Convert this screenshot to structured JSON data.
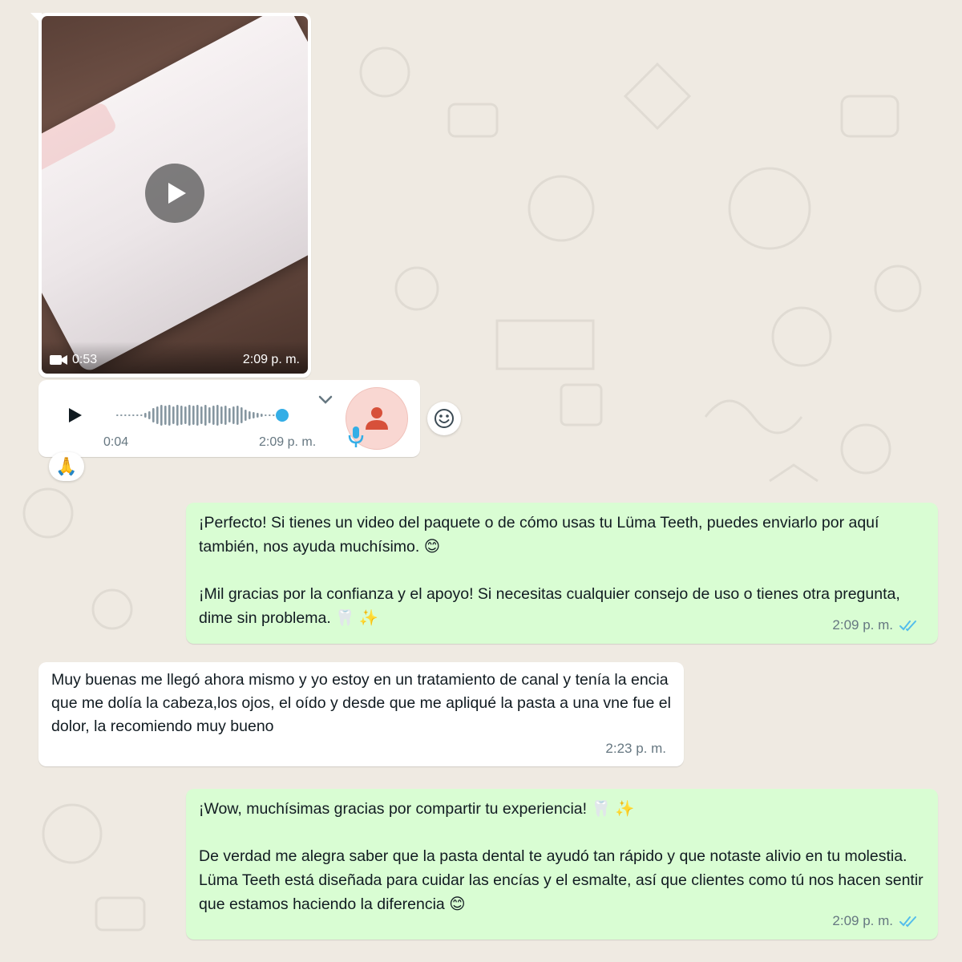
{
  "chat": {
    "video": {
      "duration": "0:53",
      "time": "2:09 p. m."
    },
    "audio": {
      "duration": "0:04",
      "time": "2:09 p. m.",
      "progress": 1.0
    },
    "reaction": "🙏",
    "messages": [
      {
        "direction": "outgoing",
        "paragraphs": [
          "¡Perfecto! Si tienes un video del paquete o de cómo usas tu Lüma Teeth, puedes enviarlo por aquí también, nos ayuda muchísimo. 😊",
          "¡Mil gracias por la confianza y el apoyo! Si necesitas cualquier consejo de uso o tienes otra pregunta, dime sin problema. 🦷 ✨"
        ],
        "time": "2:09 p. m.",
        "status": "read"
      },
      {
        "direction": "incoming",
        "paragraphs": [
          "Muy buenas me llegó ahora mismo y yo estoy en un tratamiento de canal y tenía la encia que me dolía la cabeza,los ojos, el oído y desde que me apliqué la pasta a una vne fue el dolor, la recomiendo muy bueno"
        ],
        "time": "2:23 p. m."
      },
      {
        "direction": "outgoing",
        "paragraphs": [
          "¡Wow, muchísimas gracias por compartir tu experiencia! 🦷 ✨",
          "De verdad me alegra saber que la pasta dental te ayudó tan rápido y que notaste alivio en tu molestia. Lüma Teeth está diseñada para cuidar las encías y el esmalte, así que clientes como tú nos hacen sentir que estamos haciendo la diferencia 😊"
        ],
        "time": "2:09 p. m.",
        "status": "read"
      }
    ]
  },
  "colors": {
    "background": "#efeae2",
    "outgoing_bubble": "#d9fdd3",
    "incoming_bubble": "#ffffff",
    "read_ticks": "#53bdeb",
    "meta_text": "#667781",
    "avatar_bg": "#f9d7d2",
    "avatar_icon": "#d7503a",
    "audio_accent": "#34aee6"
  },
  "icons": {
    "video_play": "play-icon",
    "video_camera": "video-camera-icon",
    "audio_play": "play-icon",
    "chevron": "chevron-down-icon",
    "avatar": "person-icon",
    "mic": "microphone-icon",
    "reaction": "smiley-icon",
    "ticks": "double-check-icon"
  }
}
